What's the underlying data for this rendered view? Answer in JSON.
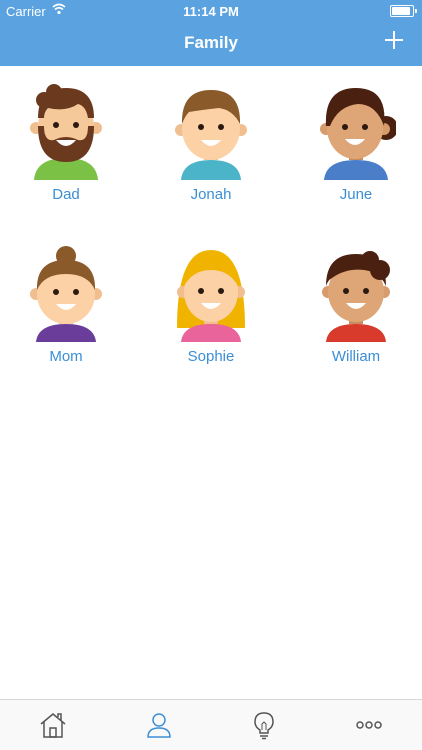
{
  "status_bar": {
    "carrier": "Carrier",
    "time": "11:14 PM"
  },
  "nav": {
    "title": "Family",
    "add_icon": "plus-icon"
  },
  "people": [
    {
      "name": "Dad",
      "avatar": "dad-avatar"
    },
    {
      "name": "Jonah",
      "avatar": "jonah-avatar"
    },
    {
      "name": "June",
      "avatar": "june-avatar"
    },
    {
      "name": "Mom",
      "avatar": "mom-avatar"
    },
    {
      "name": "Sophie",
      "avatar": "sophie-avatar"
    },
    {
      "name": "William",
      "avatar": "william-avatar"
    }
  ],
  "tabs": [
    {
      "icon": "home-icon"
    },
    {
      "icon": "person-icon",
      "selected": true
    },
    {
      "icon": "lightbulb-icon"
    },
    {
      "icon": "more-icon"
    }
  ],
  "colors": {
    "accent": "#5aa3e0",
    "link": "#3b8fd6",
    "tab_inactive": "#555555",
    "tab_active": "#3b8fd6"
  }
}
